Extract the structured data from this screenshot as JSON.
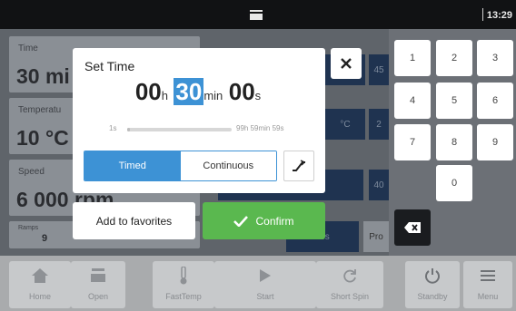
{
  "statusbar": {
    "time": "13:29",
    "icon": "folder-icon"
  },
  "background": {
    "tiles": [
      {
        "label": "Time",
        "value": "30 mi"
      },
      {
        "label": "Temperatu",
        "value": "10 °C"
      },
      {
        "label": "Speed",
        "value": "6 000 rpm"
      },
      {
        "label": "Ramps",
        "value": "9"
      }
    ],
    "partial": {
      "r1_mid": "in",
      "r1_right": "45",
      "r2_mid": "°C",
      "r2_right": "2",
      "r3_mid": "rpm",
      "r3_right": "40",
      "r4_mid": "ites",
      "r4_right": "Pro"
    }
  },
  "keypad": {
    "keys": [
      "1",
      "2",
      "3",
      "4",
      "5",
      "6",
      "7",
      "8",
      "9",
      "0"
    ]
  },
  "modal": {
    "title": "Set Time",
    "hours": "00",
    "hours_unit": "h",
    "minutes": "30",
    "minutes_unit": "min",
    "seconds": "00",
    "seconds_unit": "s",
    "slider": {
      "min_label": "1s",
      "max_label": "99h 59min 59s",
      "fraction": 0.005
    },
    "modes": {
      "timed": "Timed",
      "continuous": "Continuous",
      "selected": "Timed"
    },
    "close": "close-icon",
    "ramp": "ramp-icon"
  },
  "actions": {
    "favorites": "Add to favorites",
    "confirm": "Confirm"
  },
  "bottom_nav": [
    {
      "label": "Home",
      "icon": "home-icon"
    },
    {
      "label": "Open",
      "icon": "open-lid-icon"
    },
    {
      "label": "FastTemp",
      "icon": "thermometer-icon"
    },
    {
      "label": "Start",
      "icon": "play-icon"
    },
    {
      "label": "Short Spin",
      "icon": "short-spin-icon"
    },
    {
      "label": "Standby",
      "icon": "power-icon"
    },
    {
      "label": "Menu",
      "icon": "menu-icon"
    }
  ],
  "colors": {
    "accent": "#3d92d5",
    "confirm": "#5ab84f",
    "statusbar": "#111214"
  }
}
